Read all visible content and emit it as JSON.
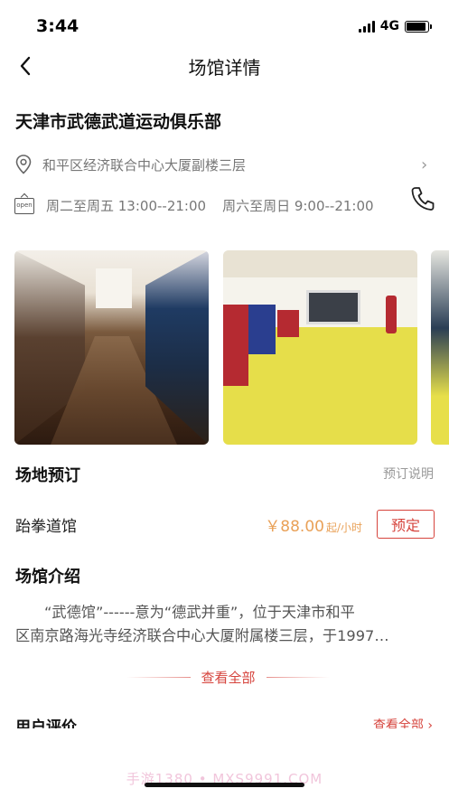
{
  "status_bar": {
    "time": "3:44",
    "network": "4G",
    "battery_level": 0.9
  },
  "nav": {
    "title": "场馆详情",
    "back_icon": "chevron-left-icon"
  },
  "venue": {
    "name": "天津市武德武道运动俱乐部",
    "address": "和平区经济联合中心大厦副楼三层",
    "hours_weekday": "周二至周五 13:00--21:00",
    "hours_weekend": "周六至周日 9:00--21:00",
    "open_tag": "open"
  },
  "booking": {
    "title": "场地预订",
    "note_link": "预订说明",
    "items": [
      {
        "name": "跆拳道馆",
        "price": "￥88.00",
        "unit": "起/小时",
        "button": "预定"
      }
    ]
  },
  "intro": {
    "title": "场馆介绍",
    "line1": "“武德馆”------意为“德武并重”，位于天津市和平",
    "line2": "区南京路海光寺经济联合中心大厦附属楼三层，于1997…",
    "view_all": "查看全部"
  },
  "reviews": {
    "title": "用户评价",
    "view_all": "查看全部 ›"
  },
  "watermark": "手游1380 • MXS9991.COM"
}
